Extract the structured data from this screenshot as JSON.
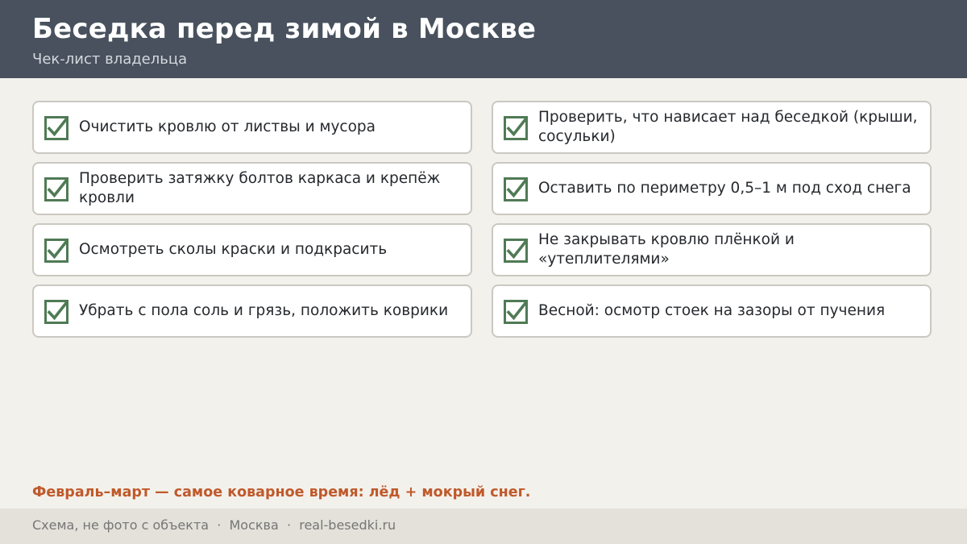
{
  "header": {
    "title": "Беседка перед зимой в Москве",
    "subtitle": "Чек-лист владельца"
  },
  "checklist": {
    "left": [
      {
        "text": "Очистить кровлю от листвы и мусора",
        "checked": true
      },
      {
        "text": "Проверить затяжку болтов каркаса и крепёж кровли",
        "checked": true
      },
      {
        "text": "Осмотреть сколы краски и подкрасить",
        "checked": true
      },
      {
        "text": "Убрать с пола соль и грязь, положить коврики",
        "checked": true
      }
    ],
    "right": [
      {
        "text": "Проверить, что нависает над беседкой (крыши, сосульки)",
        "checked": true
      },
      {
        "text": "Оставить по периметру 0,5–1 м под сход снега",
        "checked": true
      },
      {
        "text": "Не закрывать кровлю плёнкой и «утеплителями»",
        "checked": true
      },
      {
        "text": "Весной: осмотр стоек на зазоры от пучения",
        "checked": true
      }
    ]
  },
  "note": "Февраль–март — самое коварное время: лёд + мокрый снег.",
  "footer": {
    "text": "Схема, не фото с объекта  ·  Москва  ·  real-besedki.ru"
  },
  "colors": {
    "header_bg": "#48515d",
    "check_green": "#4f7a55",
    "note_accent": "#bf5a2b",
    "page_bg": "#f3f1ec"
  },
  "icons": {
    "check": "checkbox-checked-icon"
  }
}
